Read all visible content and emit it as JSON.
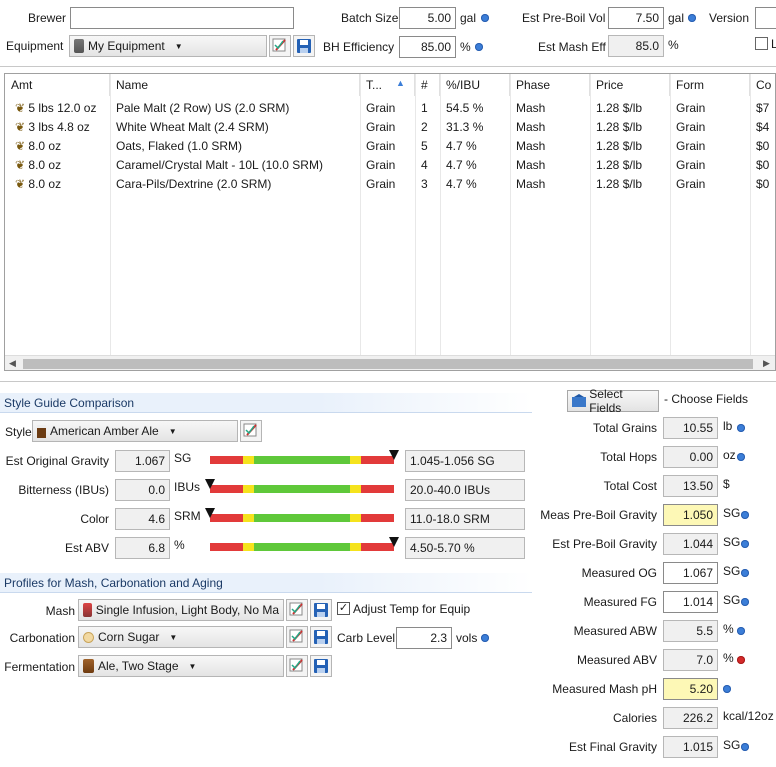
{
  "header": {
    "brewer_label": "Brewer",
    "brewer_value": "",
    "equipment_label": "Equipment",
    "equipment_value": "My Equipment",
    "batch_size_label": "Batch Size",
    "batch_size_value": "5.00",
    "batch_size_unit": "gal",
    "bh_eff_label": "BH Efficiency",
    "bh_eff_value": "85.00",
    "bh_eff_unit": "%",
    "preboil_label": "Est Pre-Boil Vol",
    "preboil_value": "7.50",
    "preboil_unit": "gal",
    "mash_eff_label": "Est Mash Eff",
    "mash_eff_value": "85.0",
    "mash_eff_unit": "%",
    "version_label": "Version",
    "lock_label": "L"
  },
  "table": {
    "columns": [
      "Amt",
      "Name",
      "T...",
      "#",
      "%/IBU",
      "Phase",
      "Price",
      "Form",
      "Co"
    ],
    "rows": [
      {
        "amt": "5 lbs 12.0 oz",
        "name": "Pale Malt (2 Row) US (2.0 SRM)",
        "type": "Grain",
        "num": "1",
        "pct": "54.5 %",
        "phase": "Mash",
        "price": "1.28 $/lb",
        "form": "Grain",
        "cost": "$7"
      },
      {
        "amt": "3 lbs 4.8 oz",
        "name": "White Wheat Malt (2.4 SRM)",
        "type": "Grain",
        "num": "2",
        "pct": "31.3 %",
        "phase": "Mash",
        "price": "1.28 $/lb",
        "form": "Grain",
        "cost": "$4"
      },
      {
        "amt": "8.0 oz",
        "name": "Oats, Flaked (1.0 SRM)",
        "type": "Grain",
        "num": "5",
        "pct": "4.7 %",
        "phase": "Mash",
        "price": "1.28 $/lb",
        "form": "Grain",
        "cost": "$0"
      },
      {
        "amt": "8.0 oz",
        "name": "Caramel/Crystal Malt - 10L (10.0 SRM)",
        "type": "Grain",
        "num": "4",
        "pct": "4.7 %",
        "phase": "Mash",
        "price": "1.28 $/lb",
        "form": "Grain",
        "cost": "$0"
      },
      {
        "amt": "8.0 oz",
        "name": "Cara-Pils/Dextrine (2.0 SRM)",
        "type": "Grain",
        "num": "3",
        "pct": "4.7 %",
        "phase": "Mash",
        "price": "1.28 $/lb",
        "form": "Grain",
        "cost": "$0"
      }
    ]
  },
  "style": {
    "section_title": "Style Guide Comparison",
    "style_label": "Style",
    "style_value": "American Amber Ale",
    "rows": [
      {
        "label": "Est Original Gravity",
        "value": "1.067",
        "unit": "SG",
        "range": "1.045-1.056 SG",
        "marker_pos": 1.0
      },
      {
        "label": "Bitterness (IBUs)",
        "value": "0.0",
        "unit": "IBUs",
        "range": "20.0-40.0 IBUs",
        "marker_pos": 0.0
      },
      {
        "label": "Color",
        "value": "4.6",
        "unit": "SRM",
        "range": "11.0-18.0 SRM",
        "marker_pos": 0.0
      },
      {
        "label": "Est ABV",
        "value": "6.8",
        "unit": "%",
        "range": "4.50-5.70 %",
        "marker_pos": 1.0
      }
    ]
  },
  "profiles": {
    "section_title": "Profiles for Mash, Carbonation and Aging",
    "mash_label": "Mash",
    "mash_value": "Single Infusion, Light Body, No Ma",
    "adjust_label": "Adjust Temp for Equip",
    "adjust_checked": true,
    "carb_label": "Carbonation",
    "carb_value": "Corn Sugar",
    "carb_level_label": "Carb Level",
    "carb_level_value": "2.3",
    "carb_level_unit": "vols",
    "ferm_label": "Fermentation",
    "ferm_value": "Ale, Two Stage"
  },
  "fields": {
    "select_button": "Select Fields",
    "choose_label": "- Choose Fields",
    "items": [
      {
        "label": "Total Grains",
        "value": "10.55",
        "unit": "lb",
        "style": "ro",
        "dot": "blue"
      },
      {
        "label": "Total Hops",
        "value": "0.00",
        "unit": "oz",
        "style": "ro",
        "dot": "blue"
      },
      {
        "label": "Total Cost",
        "value": "13.50",
        "unit": "$",
        "style": "ro",
        "dot": "none"
      },
      {
        "label": "Meas Pre-Boil Gravity",
        "value": "1.050",
        "unit": "SG",
        "style": "yel",
        "dot": "blue"
      },
      {
        "label": "Est Pre-Boil Gravity",
        "value": "1.044",
        "unit": "SG",
        "style": "ro",
        "dot": "blue"
      },
      {
        "label": "Measured OG",
        "value": "1.067",
        "unit": "SG",
        "style": "edit",
        "dot": "blue"
      },
      {
        "label": "Measured FG",
        "value": "1.014",
        "unit": "SG",
        "style": "edit",
        "dot": "blue"
      },
      {
        "label": "Measured ABW",
        "value": "5.5",
        "unit": "%",
        "style": "ro",
        "dot": "blue"
      },
      {
        "label": "Measured ABV",
        "value": "7.0",
        "unit": "%",
        "style": "ro",
        "dot": "red"
      },
      {
        "label": "Measured Mash pH",
        "value": "5.20",
        "unit": "",
        "style": "yel",
        "dot": "blue"
      },
      {
        "label": "Calories",
        "value": "226.2",
        "unit": "kcal/12oz",
        "style": "ro",
        "dot": "none"
      },
      {
        "label": "Est Final Gravity",
        "value": "1.015",
        "unit": "SG",
        "style": "ro",
        "dot": "blue"
      }
    ]
  },
  "colors": {
    "accent": "#3b7ed8",
    "section_bg": "#e9f1fb",
    "highlight": "#fdf8b6",
    "bar_red": "#e23a3a",
    "bar_yellow": "#f5e31d",
    "bar_green": "#5fc83a",
    "alert": "#d42a2a"
  }
}
